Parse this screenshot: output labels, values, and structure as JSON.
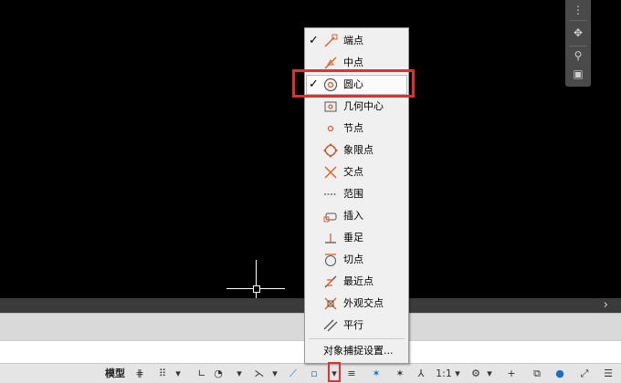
{
  "snap_menu": {
    "items": [
      {
        "label": "端点",
        "icon": "endpoint-snap-icon",
        "checked": true
      },
      {
        "label": "中点",
        "icon": "midpoint-snap-icon",
        "checked": false
      },
      {
        "label": "圆心",
        "icon": "center-snap-icon",
        "checked": true,
        "highlighted": true
      },
      {
        "label": "几何中心",
        "icon": "geometric-center-snap-icon",
        "checked": false
      },
      {
        "label": "节点",
        "icon": "node-snap-icon",
        "checked": false
      },
      {
        "label": "象限点",
        "icon": "quadrant-snap-icon",
        "checked": false
      },
      {
        "label": "交点",
        "icon": "intersection-snap-icon",
        "checked": false
      },
      {
        "label": "范围",
        "icon": "extension-snap-icon",
        "checked": false
      },
      {
        "label": "插入",
        "icon": "insertion-snap-icon",
        "checked": false
      },
      {
        "label": "垂足",
        "icon": "perpendicular-snap-icon",
        "checked": false
      },
      {
        "label": "切点",
        "icon": "tangent-snap-icon",
        "checked": false
      },
      {
        "label": "最近点",
        "icon": "nearest-snap-icon",
        "checked": false
      },
      {
        "label": "外观交点",
        "icon": "apparent-intersection-snap-icon",
        "checked": false
      },
      {
        "label": "平行",
        "icon": "parallel-snap-icon",
        "checked": false
      }
    ],
    "check_mark": "✓",
    "settings_label": "对象捕捉设置..."
  },
  "statusbar": {
    "model_label": "模型",
    "scale_label": "1:1"
  },
  "colors": {
    "snap_icon": "#d9622b",
    "highlight_box": "#e03030",
    "accent_blue": "#1a6fc4"
  }
}
